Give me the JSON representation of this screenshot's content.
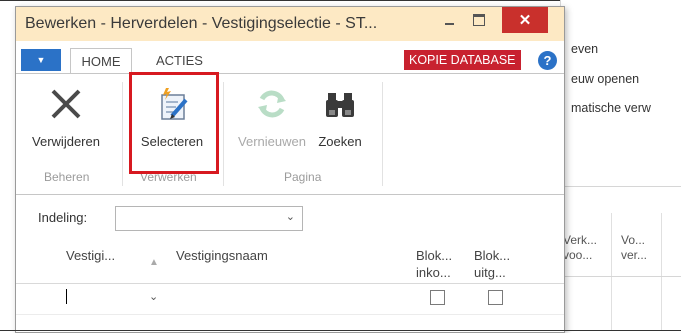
{
  "background_window": {
    "menu_items": [
      "even",
      "euw openen",
      "matische verw"
    ],
    "columns": [
      {
        "line1": "Verk...",
        "line2": "voo..."
      },
      {
        "line1": "Vo...",
        "line2": "ver..."
      }
    ]
  },
  "dialog": {
    "title": "Bewerken - Herverdelen - Vestigingselectie - ST...",
    "close_glyph": "✕",
    "tabs": {
      "home": "HOME",
      "acties": "ACTIES"
    },
    "app_button_glyph": "▼",
    "badge": "KOPIE DATABASE",
    "help_glyph": "?",
    "ribbon": {
      "buttons": {
        "verwijderen": "Verwijderen",
        "selecteren": "Selecteren",
        "vernieuwen": "Vernieuwen",
        "zoeken": "Zoeken"
      },
      "groups": {
        "beheren": "Beheren",
        "verwerken": "Verwerken",
        "pagina": "Pagina"
      },
      "icons": {
        "verwijderen": "delete-x-icon",
        "selecteren": "edit-select-icon",
        "vernieuwen": "refresh-icon",
        "zoeken": "binoculars-icon"
      }
    },
    "filter": {
      "label": "Indeling:",
      "value": ""
    },
    "table": {
      "columns": {
        "vestiging": "Vestigi...",
        "naam": "Vestigingsnaam",
        "blok_inko_1": "Blok...",
        "blok_inko_2": "inko...",
        "blok_uitg_1": "Blok...",
        "blok_uitg_2": "uitg..."
      },
      "row": {
        "vestiging": "",
        "naam": "",
        "blok_inko": false,
        "blok_uitg": false
      }
    }
  },
  "colors": {
    "titlebar": "#fde9c4",
    "accent": "#2b72c7",
    "badge": "#c8212f",
    "highlight": "#d71920"
  }
}
